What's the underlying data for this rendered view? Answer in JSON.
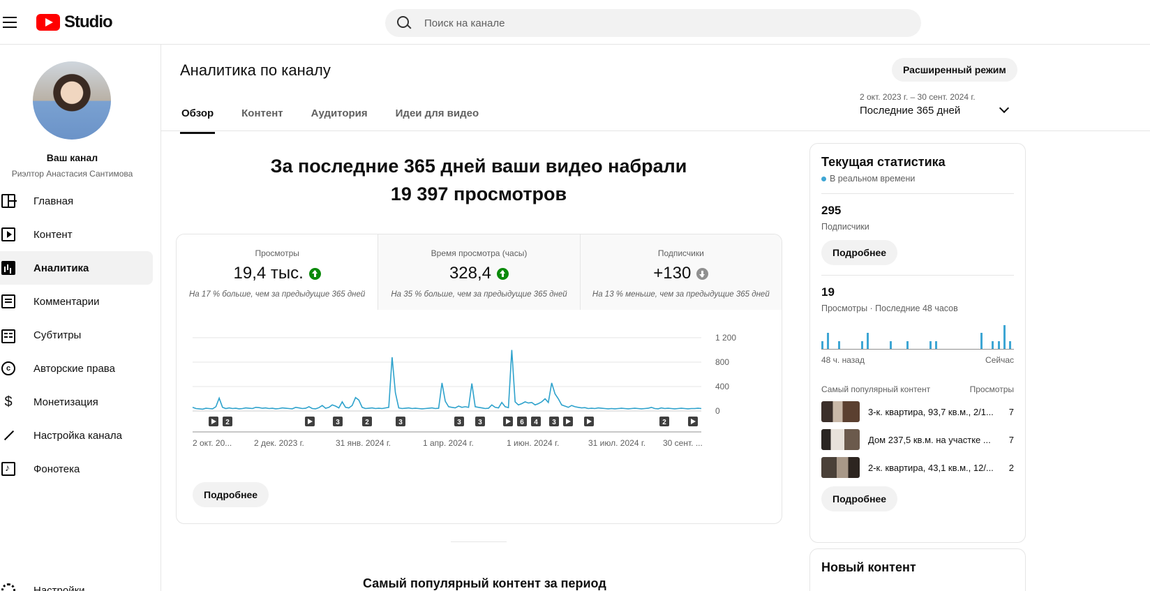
{
  "app": {
    "logo_text": "Studio"
  },
  "search": {
    "placeholder": "Поиск на канале"
  },
  "sidebar": {
    "channel_name": "Ваш канал",
    "channel_sub": "Риэлтор Анастасия Сантимова",
    "items": [
      {
        "label": "Главная",
        "icon": "dashboard-icon"
      },
      {
        "label": "Контент",
        "icon": "content-icon"
      },
      {
        "label": "Аналитика",
        "icon": "analytics-icon",
        "active": true
      },
      {
        "label": "Комментарии",
        "icon": "comments-icon"
      },
      {
        "label": "Субтитры",
        "icon": "subtitles-icon"
      },
      {
        "label": "Авторские права",
        "icon": "copyright-icon"
      },
      {
        "label": "Монетизация",
        "icon": "monetization-icon"
      },
      {
        "label": "Настройка канала",
        "icon": "customization-icon"
      },
      {
        "label": "Фонотека",
        "icon": "audio-library-icon"
      }
    ],
    "settings_label": "Настройки"
  },
  "header": {
    "title": "Аналитика по каналу",
    "advanced_label": "Расширенный режим",
    "tabs": [
      "Обзор",
      "Контент",
      "Аудитория",
      "Идеи для видео"
    ],
    "date_range_sub": "2 окт. 2023 г. – 30 сент. 2024 г.",
    "date_range_main": "Последние 365 дней"
  },
  "summary": {
    "line1": "За последние 365 дней ваши видео набрали",
    "line2": "19 397 просмотров"
  },
  "metrics": [
    {
      "label": "Просмотры",
      "value": "19,4 тыс.",
      "trend": "up",
      "note": "На 17 % больше, чем за предыдущие 365 дней"
    },
    {
      "label": "Время просмотра (часы)",
      "value": "328,4",
      "trend": "up",
      "note": "На 35 % больше, чем за предыдущие 365 дней"
    },
    {
      "label": "Подписчики",
      "value": "+130",
      "trend": "down",
      "note": "На 13 % меньше, чем за предыдущие 365 дней"
    }
  ],
  "main_more_label": "Подробнее",
  "chart_data": {
    "type": "line",
    "series": [
      {
        "values": [
          60,
          40,
          35,
          30,
          45,
          40,
          35,
          70,
          210,
          60,
          40,
          50,
          40,
          45,
          35,
          40,
          50,
          45,
          40,
          60,
          55,
          45,
          50,
          40,
          45,
          35,
          40,
          50,
          45,
          40,
          35,
          60,
          50,
          40,
          45,
          70,
          40,
          35,
          55,
          90,
          45,
          60,
          100,
          80,
          50,
          150,
          60,
          50,
          90,
          220,
          180,
          60,
          40,
          45,
          50,
          40,
          45,
          40,
          50,
          60,
          880,
          300,
          50,
          40,
          45,
          50,
          40,
          45,
          40,
          35,
          40,
          45,
          50,
          40,
          45,
          460,
          160,
          70,
          60,
          50,
          80,
          60,
          70,
          60,
          450,
          70,
          60,
          50,
          40,
          45,
          100,
          60,
          50,
          140,
          70,
          55,
          1000,
          150,
          100,
          120,
          150,
          130,
          140,
          100,
          120,
          150,
          200,
          140,
          460,
          280,
          200,
          100,
          80,
          60,
          90,
          70,
          60,
          50,
          55,
          40,
          45,
          40,
          50,
          45,
          40,
          35,
          40,
          35,
          40,
          45,
          40,
          35,
          40,
          45,
          40,
          35,
          40,
          45,
          60,
          40,
          35,
          50,
          40,
          45,
          40,
          35,
          40,
          45,
          40,
          35,
          40,
          40,
          45,
          40
        ]
      }
    ],
    "x_tick_labels": [
      "2 окт. 20...",
      "2 дек. 2023 г.",
      "31 янв. 2024 г.",
      "1 апр. 2024 г.",
      "1 июн. 2024 г.",
      "31 июл. 2024 г.",
      "30 сент. ..."
    ],
    "y_tick_labels": [
      "1 200",
      "800",
      "400",
      "0"
    ],
    "ylim": [
      0,
      1200
    ],
    "grid": true,
    "markers": [
      "play",
      "2",
      "play",
      "3",
      "2",
      "3",
      "3",
      "3",
      "play",
      "6",
      "4",
      "3",
      "play",
      "play",
      "2",
      "play"
    ]
  },
  "realtime": {
    "title": "Текущая статистика",
    "live_label": "В реальном времени",
    "subs_value": "295",
    "subs_label": "Подписчики",
    "more_label": "Подробнее",
    "views_value": "19",
    "views_label": "Просмотры · Последние 48 часов",
    "bar_values": [
      1,
      2,
      0,
      1,
      0,
      0,
      0,
      1,
      2,
      0,
      0,
      0,
      1,
      0,
      0,
      1,
      0,
      0,
      0,
      1,
      1,
      0,
      0,
      0,
      0,
      0,
      0,
      0,
      2,
      0,
      1,
      1,
      3,
      1
    ],
    "axis_left": "48 ч. назад",
    "axis_right": "Сейчас",
    "popular_head_left": "Самый популярный контент",
    "popular_head_right": "Просмотры",
    "popular": [
      {
        "title": "3-к. квартира, 93,7 кв.м., 2/1...",
        "views": "7"
      },
      {
        "title": "Дом 237,5 кв.м. на участке ...",
        "views": "7"
      },
      {
        "title": "2-к. квартира, 43,1 кв.м., 12/...",
        "views": "2"
      }
    ],
    "more_label_2": "Подробнее"
  },
  "new_content": {
    "title": "Новый контент"
  },
  "popular_period_title": "Самый популярный контент за период"
}
